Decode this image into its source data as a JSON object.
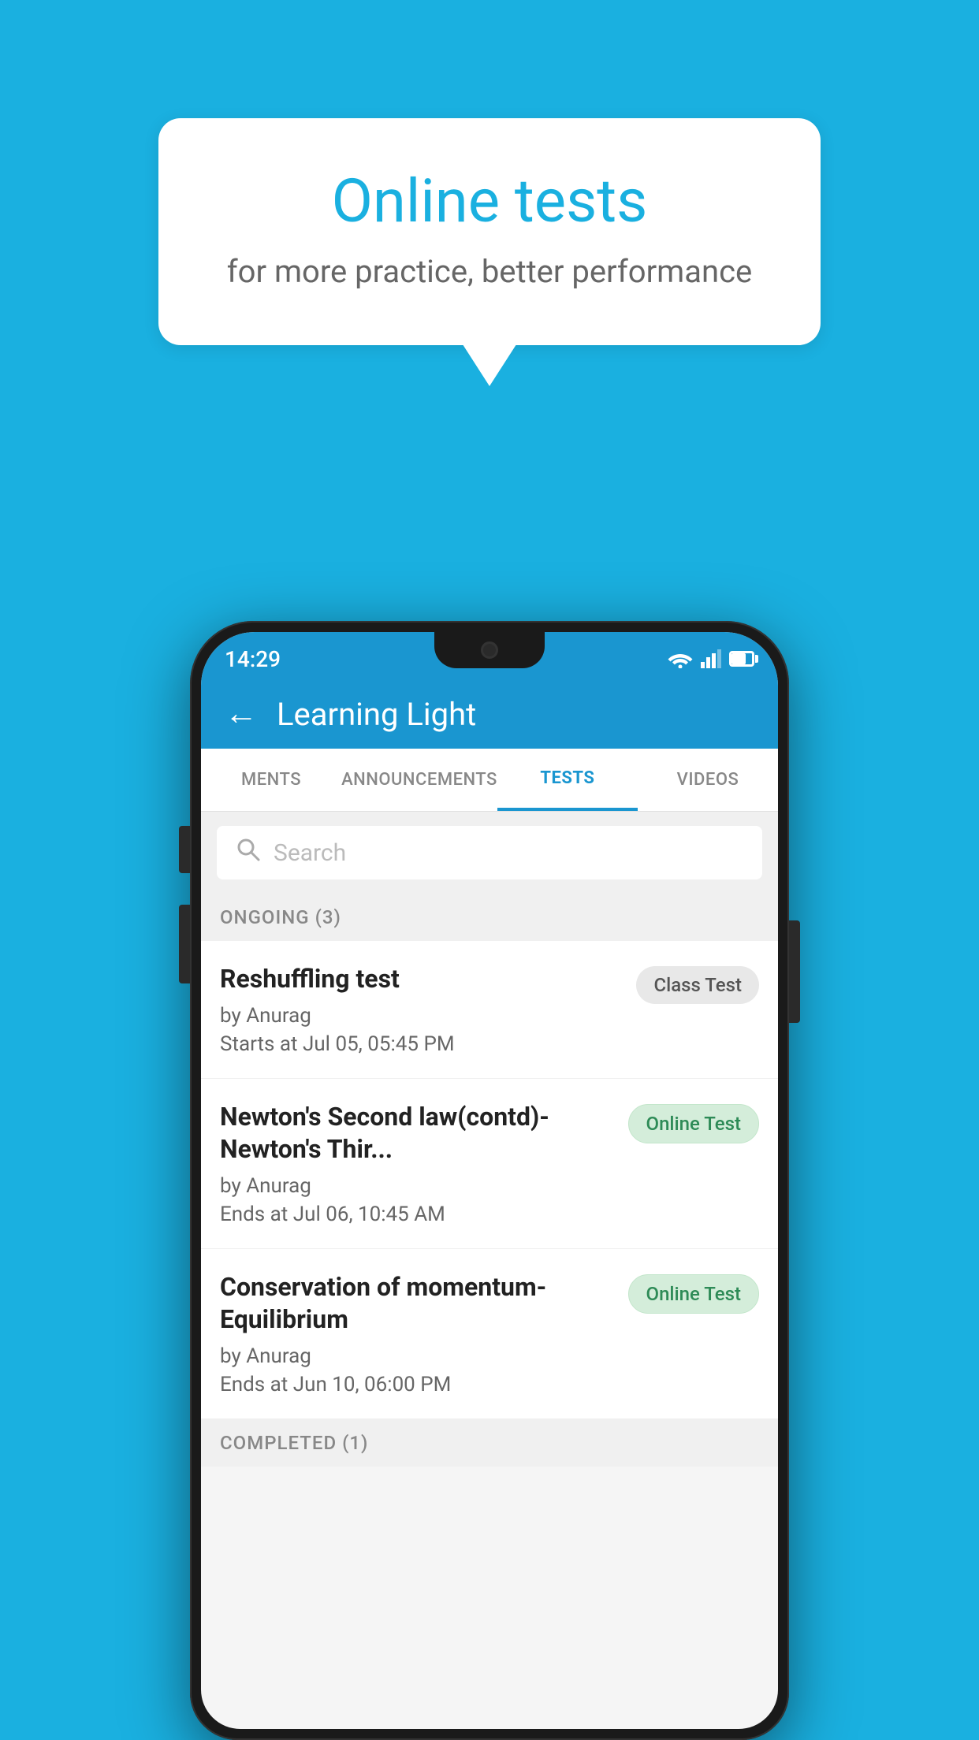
{
  "background_color": "#1ab0e0",
  "speech_bubble": {
    "title": "Online tests",
    "subtitle": "for more practice, better performance"
  },
  "phone": {
    "status_bar": {
      "time": "14:29",
      "wifi": "▼",
      "signal": "▲",
      "battery": "battery"
    },
    "header": {
      "back_label": "←",
      "title": "Learning Light"
    },
    "tabs": [
      {
        "label": "MENTS",
        "active": false
      },
      {
        "label": "ANNOUNCEMENTS",
        "active": false
      },
      {
        "label": "TESTS",
        "active": true
      },
      {
        "label": "VIDEOS",
        "active": false
      }
    ],
    "search": {
      "placeholder": "Search"
    },
    "ongoing_section": {
      "label": "ONGOING (3)",
      "tests": [
        {
          "name": "Reshuffling test",
          "by": "by Anurag",
          "time": "Starts at  Jul 05, 05:45 PM",
          "badge": "Class Test",
          "badge_type": "class"
        },
        {
          "name": "Newton's Second law(contd)-Newton's Thir...",
          "by": "by Anurag",
          "time": "Ends at  Jul 06, 10:45 AM",
          "badge": "Online Test",
          "badge_type": "online"
        },
        {
          "name": "Conservation of momentum-Equilibrium",
          "by": "by Anurag",
          "time": "Ends at  Jun 10, 06:00 PM",
          "badge": "Online Test",
          "badge_type": "online"
        }
      ]
    },
    "completed_section": {
      "label": "COMPLETED (1)"
    }
  }
}
